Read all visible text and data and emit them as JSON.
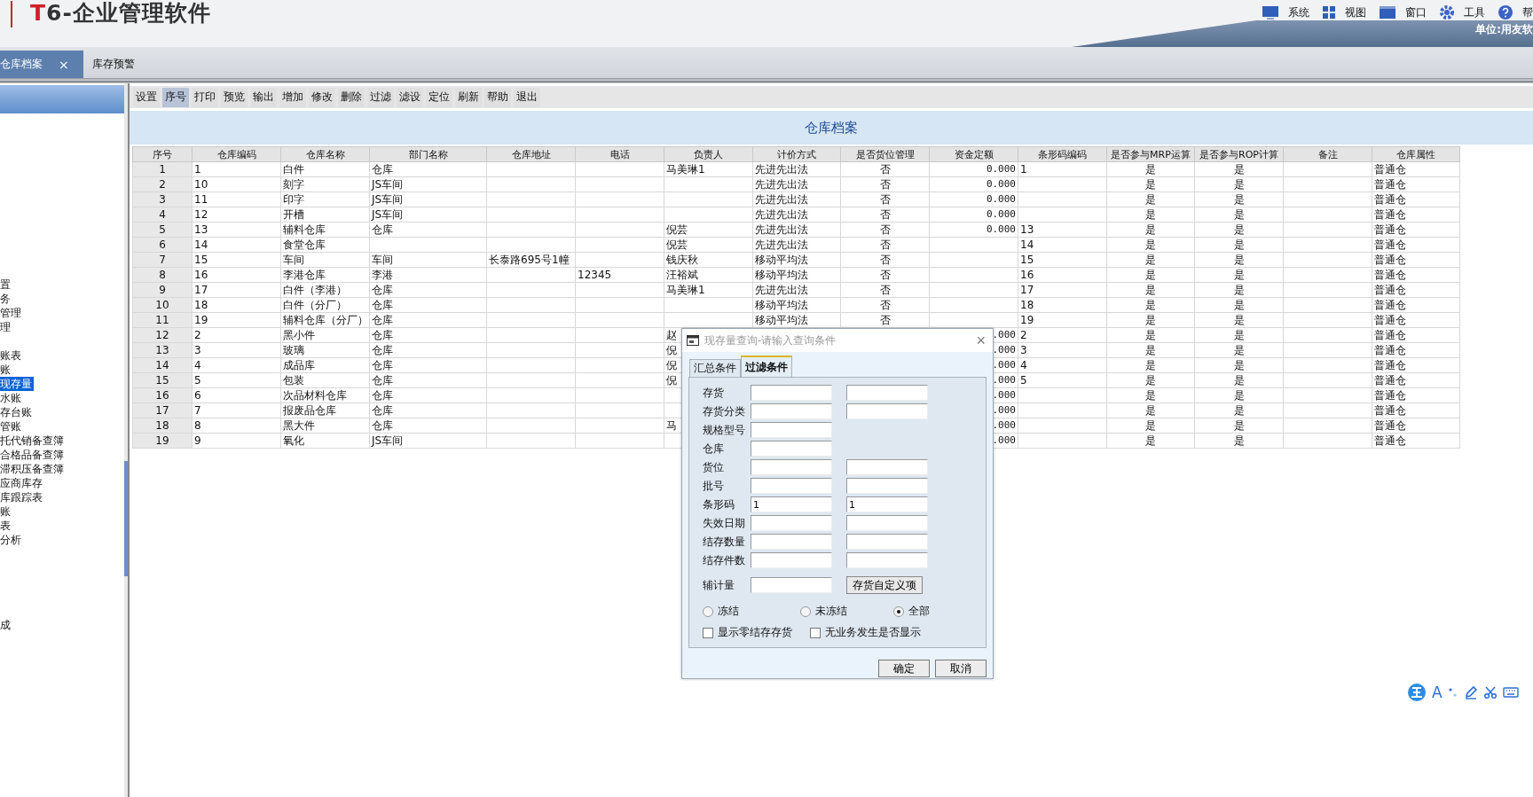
{
  "header": {
    "logo": "T6-企业管理软件",
    "menu": [
      {
        "label": "系统",
        "kind": "system"
      },
      {
        "label": "视图",
        "kind": "view"
      },
      {
        "label": "窗口",
        "kind": "window"
      },
      {
        "label": "工具",
        "kind": "tools"
      },
      {
        "label": "帮",
        "kind": "help"
      }
    ],
    "unit": "单位:用友软"
  },
  "tabs": [
    {
      "label": "仓库档案",
      "selected": true,
      "close": "×"
    },
    {
      "label": "库存预警",
      "selected": false
    }
  ],
  "sidebar": {
    "groups": [
      {
        "items": [
          {
            "label": "置",
            "selected": false
          },
          {
            "label": "务",
            "selected": false
          },
          {
            "label": "管理",
            "selected": false
          },
          {
            "label": "理",
            "selected": false
          }
        ]
      },
      {
        "items": [
          {
            "label": "账表",
            "selected": false
          },
          {
            "label": "账",
            "selected": false
          },
          {
            "label": "现存量",
            "selected": true
          },
          {
            "label": "水账",
            "selected": false
          },
          {
            "label": "存台账",
            "selected": false
          },
          {
            "label": "管账",
            "selected": false
          },
          {
            "label": "托代销备查簿",
            "selected": false
          },
          {
            "label": "合格品备查簿",
            "selected": false
          },
          {
            "label": "滞积压备查簿",
            "selected": false
          },
          {
            "label": "应商库存",
            "selected": false
          },
          {
            "label": "库跟踪表",
            "selected": false
          },
          {
            "label": "账",
            "selected": false
          },
          {
            "label": "表",
            "selected": false
          },
          {
            "label": "分析",
            "selected": false
          }
        ]
      },
      {
        "items": [
          {
            "label": "成",
            "selected": false
          }
        ]
      }
    ]
  },
  "toolbar": [
    {
      "label": "设置",
      "selected": false
    },
    {
      "label": "序号",
      "selected": true
    },
    {
      "label": "打印",
      "selected": false
    },
    {
      "label": "预览",
      "selected": false
    },
    {
      "label": "输出",
      "selected": false
    },
    {
      "label": "增加",
      "selected": false
    },
    {
      "label": "修改",
      "selected": false
    },
    {
      "label": "删除",
      "selected": false
    },
    {
      "label": "过滤",
      "selected": false
    },
    {
      "label": "滤设",
      "selected": false
    },
    {
      "label": "定位",
      "selected": false
    },
    {
      "label": "刷新",
      "selected": false
    },
    {
      "label": "帮助",
      "selected": false
    },
    {
      "label": "退出",
      "selected": false
    }
  ],
  "table": {
    "title": "仓库档案",
    "columns": [
      "序号",
      "仓库编码",
      "仓库名称",
      "部门名称",
      "仓库地址",
      "电话",
      "负责人",
      "计价方式",
      "是否货位管理",
      "资金定额",
      "条形码编码",
      "是否参与MRP运算",
      "是否参与ROP计算",
      "备注",
      "仓库属性"
    ],
    "rows": [
      [
        "1",
        "1",
        "白件",
        "仓库",
        null,
        null,
        "马美琳1",
        "先进先出法",
        "否",
        "0.000",
        "1",
        "是",
        "是",
        null,
        "普通仓"
      ],
      [
        "2",
        "10",
        "刻字",
        "JS车间",
        null,
        null,
        null,
        "先进先出法",
        "否",
        "0.000",
        null,
        "是",
        "是",
        null,
        "普通仓"
      ],
      [
        "3",
        "11",
        "印字",
        "JS车间",
        null,
        null,
        null,
        "先进先出法",
        "否",
        "0.000",
        null,
        "是",
        "是",
        null,
        "普通仓"
      ],
      [
        "4",
        "12",
        "开槽",
        "JS车间",
        null,
        null,
        null,
        "先进先出法",
        "否",
        "0.000",
        null,
        "是",
        "是",
        null,
        "普通仓"
      ],
      [
        "5",
        "13",
        "辅料仓库",
        "仓库",
        null,
        null,
        "倪芸",
        "先进先出法",
        "否",
        "0.000",
        "13",
        "是",
        "是",
        null,
        "普通仓"
      ],
      [
        "6",
        "14",
        "食堂仓库",
        null,
        null,
        null,
        "倪芸",
        "先进先出法",
        "否",
        null,
        "14",
        "是",
        "是",
        null,
        "普通仓"
      ],
      [
        "7",
        "15",
        "车间",
        "车间",
        "长泰路695号1幢",
        null,
        "钱庆秋",
        "移动平均法",
        "否",
        null,
        "15",
        "是",
        "是",
        null,
        "普通仓"
      ],
      [
        "8",
        "16",
        "李港仓库",
        "李港",
        null,
        "12345",
        "汪裕斌",
        "移动平均法",
        "否",
        null,
        "16",
        "是",
        "是",
        null,
        "普通仓"
      ],
      [
        "9",
        "17",
        "白件（李港）",
        "仓库",
        null,
        null,
        "马美琳1",
        "先进先出法",
        "否",
        null,
        "17",
        "是",
        "是",
        null,
        "普通仓"
      ],
      [
        "10",
        "18",
        "白件（分厂）",
        "仓库",
        null,
        null,
        null,
        "移动平均法",
        "否",
        null,
        "18",
        "是",
        "是",
        null,
        "普通仓"
      ],
      [
        "11",
        "19",
        "辅料仓库（分厂）",
        "仓库",
        null,
        null,
        null,
        "移动平均法",
        "否",
        null,
        "19",
        "是",
        "是",
        null,
        "普通仓"
      ],
      [
        "12",
        "2",
        "黑小件",
        "仓库",
        null,
        null,
        "赵",
        null,
        null,
        ".000",
        "2",
        "是",
        "是",
        null,
        "普通仓"
      ],
      [
        "13",
        "3",
        "玻璃",
        "仓库",
        null,
        null,
        "倪",
        null,
        null,
        ".000",
        "3",
        "是",
        "是",
        null,
        "普通仓"
      ],
      [
        "14",
        "4",
        "成品库",
        "仓库",
        null,
        null,
        "倪",
        null,
        null,
        ".000",
        "4",
        "是",
        "是",
        null,
        "普通仓"
      ],
      [
        "15",
        "5",
        "包装",
        "仓库",
        null,
        null,
        "倪",
        null,
        null,
        ".000",
        "5",
        "是",
        "是",
        null,
        "普通仓"
      ],
      [
        "16",
        "6",
        "次品材料仓库",
        "仓库",
        null,
        null,
        null,
        null,
        null,
        ".000",
        null,
        "是",
        "是",
        null,
        "普通仓"
      ],
      [
        "17",
        "7",
        "报废品仓库",
        "仓库",
        null,
        null,
        null,
        null,
        null,
        ".000",
        null,
        "是",
        "是",
        null,
        "普通仓"
      ],
      [
        "18",
        "8",
        "黑大件",
        "仓库",
        null,
        null,
        "马",
        null,
        null,
        ".000",
        null,
        "是",
        "是",
        null,
        "普通仓"
      ],
      [
        "19",
        "9",
        "氧化",
        "JS车间",
        null,
        null,
        null,
        null,
        null,
        ".000",
        null,
        "是",
        "是",
        null,
        "普通仓"
      ]
    ]
  },
  "dialog": {
    "title": "现存量查询-请输入查询条件",
    "close": "×",
    "tabs": [
      {
        "label": "汇总条件",
        "selected": false
      },
      {
        "label": "过滤条件",
        "selected": true
      }
    ],
    "fields": [
      {
        "label": "存货",
        "kind": "range"
      },
      {
        "label": "存货分类",
        "kind": "range"
      },
      {
        "label": "规格型号",
        "kind": "single"
      },
      {
        "label": "仓库",
        "kind": "single"
      },
      {
        "label": "货位",
        "kind": "range"
      },
      {
        "label": "批号",
        "kind": "range"
      },
      {
        "label": "条形码",
        "kind": "range",
        "from": "1",
        "to": "1"
      },
      {
        "label": "失效日期",
        "kind": "range"
      },
      {
        "label": "结存数量",
        "kind": "range"
      },
      {
        "label": "结存件数",
        "kind": "range"
      },
      {
        "label": "辅计量",
        "kind": "single",
        "button": "存货自定义项"
      }
    ],
    "radios": [
      {
        "label": "冻结",
        "selected": false
      },
      {
        "label": "未冻结",
        "selected": false
      },
      {
        "label": "全部",
        "selected": true
      }
    ],
    "checkboxes": [
      {
        "label": "显示零结存存货",
        "checked": false
      },
      {
        "label": "无业务发生是否显示",
        "checked": false
      }
    ],
    "buttons": [
      "确定",
      "取消"
    ]
  },
  "ime_toolbar": {
    "mode": "A"
  }
}
